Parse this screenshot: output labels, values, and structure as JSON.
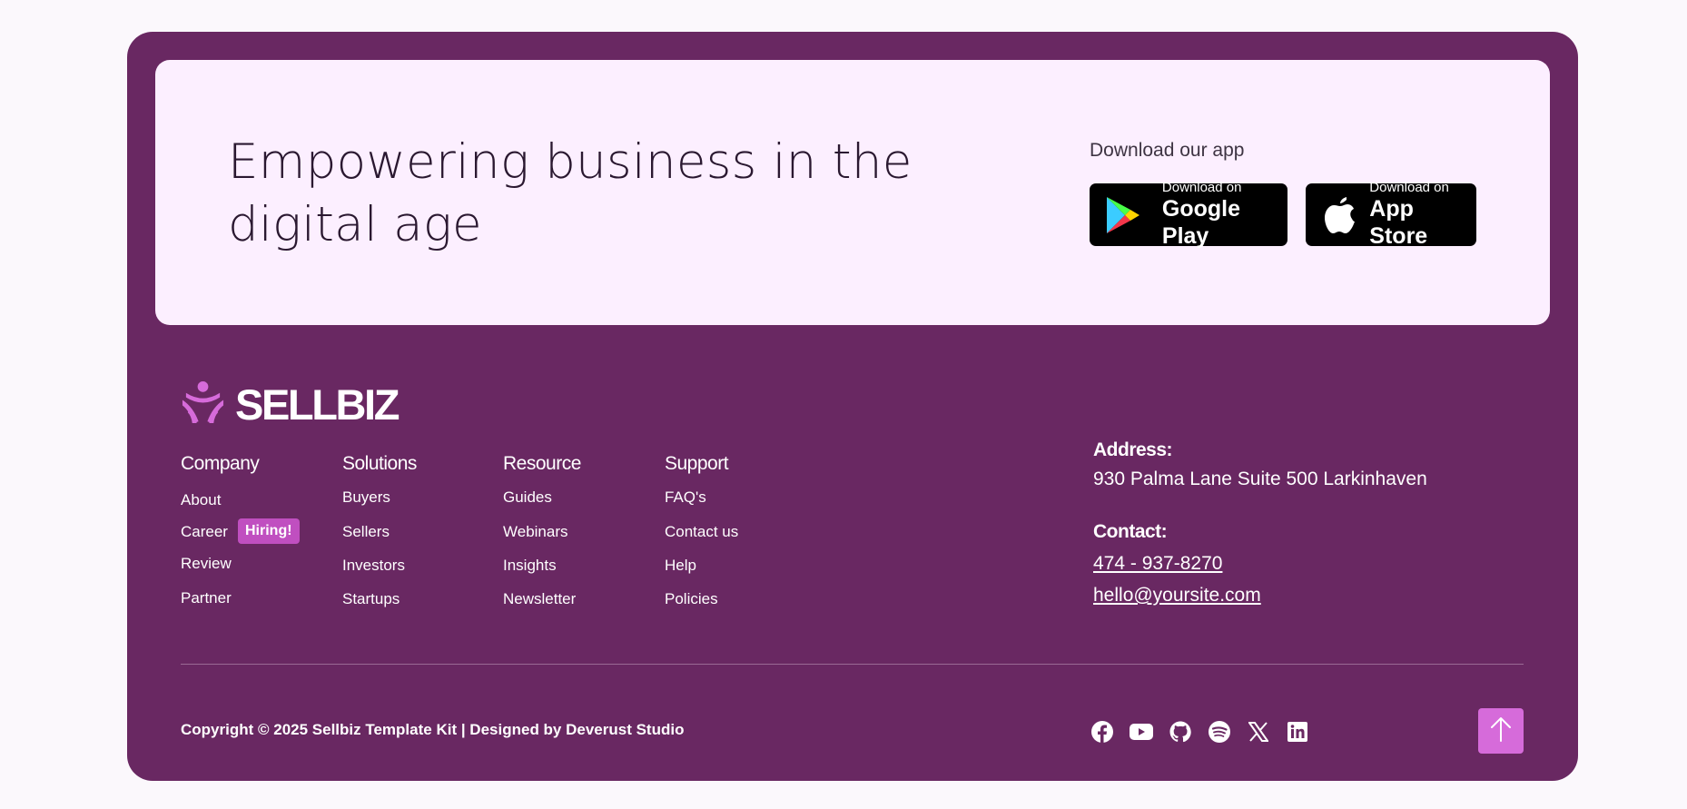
{
  "cta": {
    "title": "Empowering business in the digital age",
    "download_label": "Download our app",
    "google_play": {
      "small": "Download on",
      "big": "Google Play",
      "icon": "google-play-icon"
    },
    "app_store": {
      "small": "Download on",
      "big": "App Store",
      "icon": "apple-icon"
    }
  },
  "brand": {
    "name": "SELLBIZ",
    "logo_color": "#d66bda"
  },
  "columns": [
    {
      "title": "Company",
      "links": [
        "About",
        "Career",
        "Review",
        "Partner"
      ]
    },
    {
      "title": "Solutions",
      "links": [
        "Buyers",
        "Sellers",
        "Investors",
        "Startups"
      ]
    },
    {
      "title": "Resource",
      "links": [
        "Guides",
        "Webinars",
        "Insights",
        "Newsletter"
      ]
    },
    {
      "title": "Support",
      "links": [
        "FAQ's",
        "Contact us",
        "Help",
        "Policies"
      ]
    }
  ],
  "hiring_badge": "Hiring!",
  "address": {
    "label": "Address:",
    "value": "930 Palma Lane Suite 500 Larkinhaven"
  },
  "contact": {
    "label": "Contact:",
    "phone": "474 - 937-8270",
    "email": "hello@yoursite.com"
  },
  "copyright": "Copyright © 2025 Sellbiz Template Kit | Designed by Deverust Studio",
  "socials": [
    "facebook-icon",
    "youtube-icon",
    "github-icon",
    "spotify-icon",
    "x-icon",
    "linkedin-icon"
  ],
  "colors": {
    "footer_bg": "#692862",
    "cta_bg": "#fcefff",
    "accent": "#d66bda",
    "badge": "#c04fc0"
  }
}
